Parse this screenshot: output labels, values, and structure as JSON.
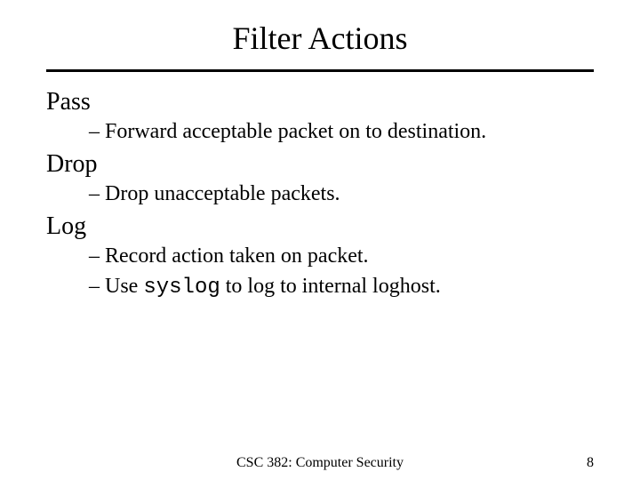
{
  "title": "Filter Actions",
  "items": [
    {
      "heading": "Pass",
      "subs": [
        {
          "pre": "– Forward acceptable packet on to destination.",
          "mono": "",
          "post": ""
        }
      ]
    },
    {
      "heading": "Drop",
      "subs": [
        {
          "pre": "– Drop unacceptable packets.",
          "mono": "",
          "post": ""
        }
      ]
    },
    {
      "heading": "Log",
      "subs": [
        {
          "pre": "– Record action taken on packet.",
          "mono": "",
          "post": ""
        },
        {
          "pre": "– Use ",
          "mono": "syslog",
          "post": " to log to internal loghost."
        }
      ]
    }
  ],
  "footer": {
    "course": "CSC 382: Computer Security",
    "page": "8"
  }
}
